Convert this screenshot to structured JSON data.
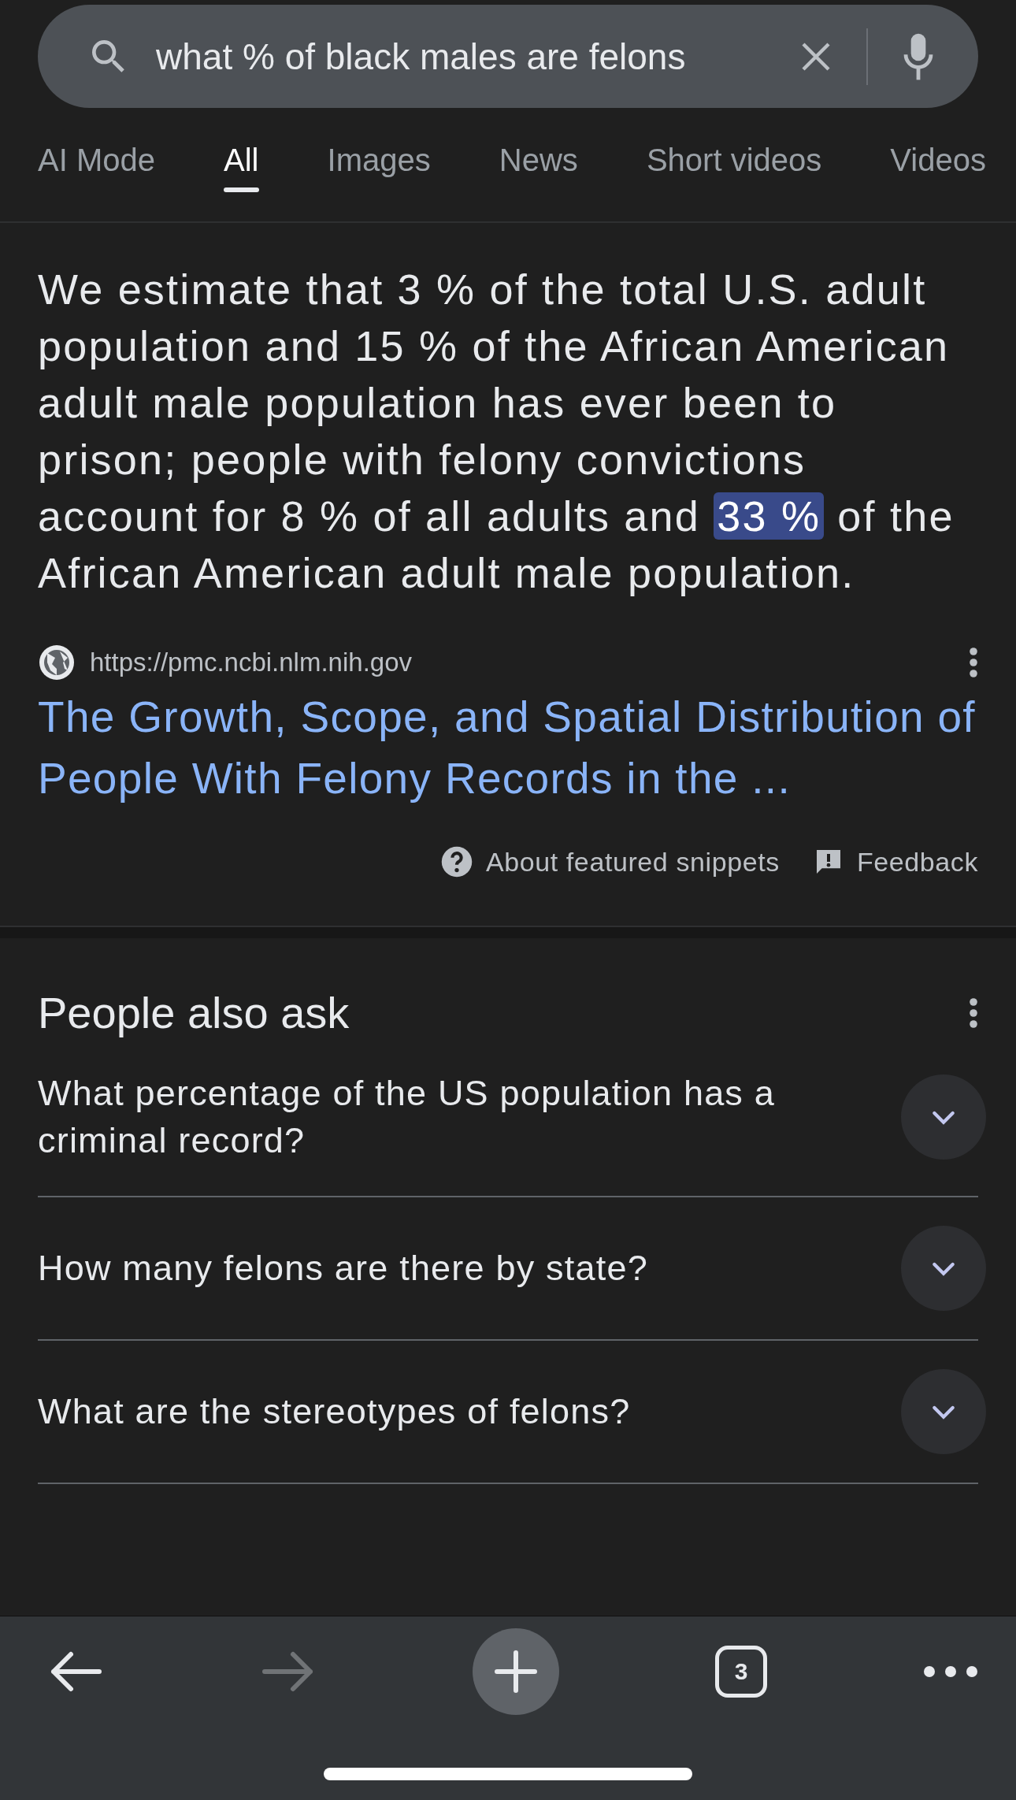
{
  "search": {
    "query": "what % of black males are felons"
  },
  "tabs": [
    {
      "label": "AI Mode",
      "selected": false
    },
    {
      "label": "All",
      "selected": true
    },
    {
      "label": "Images",
      "selected": false
    },
    {
      "label": "News",
      "selected": false
    },
    {
      "label": "Short videos",
      "selected": false
    },
    {
      "label": "Videos",
      "selected": false
    }
  ],
  "snippet": {
    "text_before": "We estimate that 3 % of the total U.S. adult population and 15 % of the African American adult male population has ever been to prison; people with felony convictions account for 8 % of all adults and ",
    "highlight": "33 %",
    "text_after": " of the African American adult male population.",
    "source_url": "https://pmc.ncbi.nlm.nih.gov",
    "title": "The Growth, Scope, and Spatial Distribution of People With Felony Records in the ...",
    "about": "About featured snippets",
    "feedback": "Feedback"
  },
  "people_also_ask": {
    "heading": "People also ask",
    "questions": [
      {
        "text": "What percentage of the US population has a criminal record?",
        "expanded": false
      },
      {
        "text": "How many felons are there by state?",
        "expanded": false
      },
      {
        "text": "What are the stereotypes of felons?",
        "expanded": false
      }
    ]
  },
  "bottom_bar": {
    "tab_count": "3",
    "forward_disabled": true
  }
}
